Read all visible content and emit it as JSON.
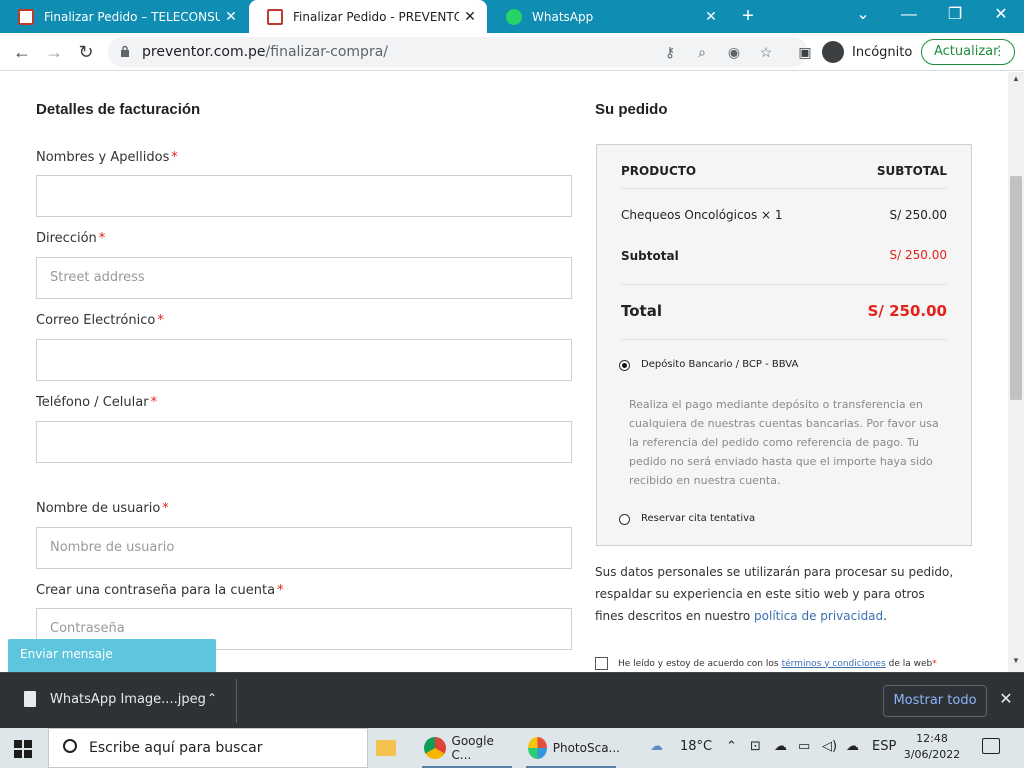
{
  "browser": {
    "tabs": [
      {
        "title": "Finalizar Pedido – TELECONSULTAS"
      },
      {
        "title": "Finalizar Pedido - PREVENTOR - E"
      },
      {
        "title": "WhatsApp"
      }
    ],
    "new_tab": "+",
    "url_domain": "preventor.com.pe",
    "url_path": "/finalizar-compra/",
    "incognito_label": "Incógnito",
    "update_label": "Actualizar"
  },
  "billing": {
    "heading": "Detalles de facturación",
    "fields": [
      {
        "label": "Nombres y Apellidos",
        "placeholder": "",
        "required": "*"
      },
      {
        "label": "Dirección",
        "placeholder": "Street address",
        "required": "*"
      },
      {
        "label": "Correo Electrónico",
        "placeholder": "",
        "required": "*"
      },
      {
        "label": "Teléfono / Celular",
        "placeholder": "",
        "required": "*"
      },
      {
        "label": "Nombre de usuario",
        "placeholder": "Nombre de usuario",
        "required": "*"
      },
      {
        "label": "Crear una contraseña para la cuenta",
        "placeholder": "Contraseña",
        "required": "*"
      }
    ]
  },
  "order": {
    "heading": "Su pedido",
    "col_product": "PRODUCTO",
    "col_subtotal": "SUBTOTAL",
    "item_name": "Chequeos Oncológicos",
    "item_qty": "× 1",
    "item_price": "S/ 250.00",
    "subtotal_label": "Subtotal",
    "subtotal_value": "S/ 250.00",
    "total_label": "Total",
    "total_value": "S/ 250.00",
    "payment_options": [
      {
        "label": "Depósito Bancario / BCP - BBVA",
        "selected": true
      },
      {
        "label": "Reservar cita tentativa",
        "selected": false
      }
    ],
    "payment_description": "Realiza el pago mediante depósito o transferencia en cualquiera de nuestras cuentas bancarias. Por favor usa la referencia del pedido como referencia de pago. Tu pedido no será enviado hasta que el importe haya sido recibido en nuestra cuenta."
  },
  "privacy": {
    "text": "Sus datos personales se utilizarán para procesar su pedido, respaldar su experiencia en este sitio web y para otros fines descritos en nuestro",
    "link": "política de privacidad",
    "end": "."
  },
  "terms": {
    "prefix": "He leído y estoy de acuerdo con los",
    "link": "términos y condiciones",
    "suffix": "de la web",
    "required": "*"
  },
  "chat_widget": {
    "label": "Enviar mensaje"
  },
  "download_bar": {
    "file_name": "WhatsApp Image....jpeg",
    "show_all": "Mostrar todo"
  },
  "taskbar": {
    "search_placeholder": "Escribe aquí para buscar",
    "apps": [
      {
        "label": "Google C..."
      },
      {
        "label": "PhotoSca..."
      }
    ],
    "temperature": "18°C",
    "language": "ESP",
    "time": "12:48",
    "date": "3/06/2022"
  },
  "colors": {
    "accent_red": "#e2231a",
    "tabstrip": "#0f8db3",
    "chat_widget": "#5ec5de",
    "link": "#3a6fb0"
  }
}
